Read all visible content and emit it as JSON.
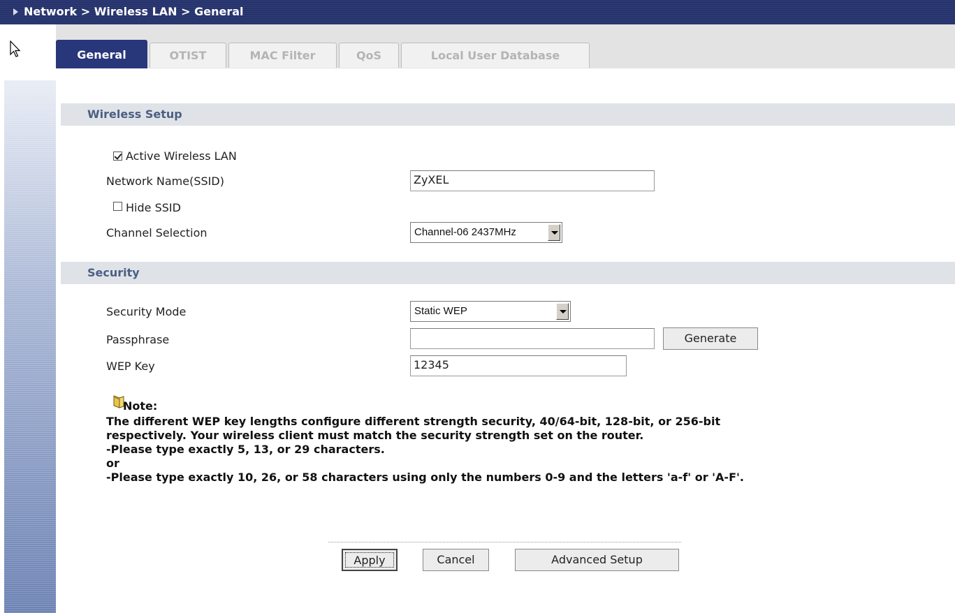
{
  "breadcrumb": "Network > Wireless LAN > General",
  "tabs": [
    {
      "label": "General",
      "active": true
    },
    {
      "label": "OTIST",
      "active": false
    },
    {
      "label": "MAC Filter",
      "active": false
    },
    {
      "label": "QoS",
      "active": false
    },
    {
      "label": "Local User Database",
      "active": false
    }
  ],
  "wireless_setup": {
    "title": "Wireless Setup",
    "active_wlan": {
      "label": "Active Wireless LAN",
      "checked": true
    },
    "ssid": {
      "label": "Network Name(SSID)",
      "value": "ZyXEL"
    },
    "hide_ssid": {
      "label": "Hide SSID",
      "checked": false
    },
    "channel": {
      "label": "Channel Selection",
      "value": "Channel-06 2437MHz"
    }
  },
  "security": {
    "title": "Security",
    "mode": {
      "label": "Security Mode",
      "value": "Static WEP"
    },
    "passphrase": {
      "label": "Passphrase",
      "value": ""
    },
    "generate_label": "Generate",
    "wep_key": {
      "label": "WEP Key",
      "value": "12345"
    }
  },
  "note": {
    "title": "Note:",
    "lines": [
      "The different WEP key lengths configure different strength security, 40/64-bit, 128-bit, or 256-bit",
      "respectively. Your wireless client must match the security strength set on the router.",
      "-Please type exactly 5, 13, or 29 characters.",
      "or",
      "-Please type exactly 10, 26, or 58 characters using only the numbers 0-9 and the letters 'a-f' or 'A-F'."
    ]
  },
  "buttons": {
    "apply": "Apply",
    "cancel": "Cancel",
    "advanced": "Advanced Setup"
  },
  "colors": {
    "header_bg": "#25326c",
    "tab_active_bg": "#28367a",
    "section_bar_bg": "#dfe3e8",
    "section_title": "#4b5f83"
  }
}
